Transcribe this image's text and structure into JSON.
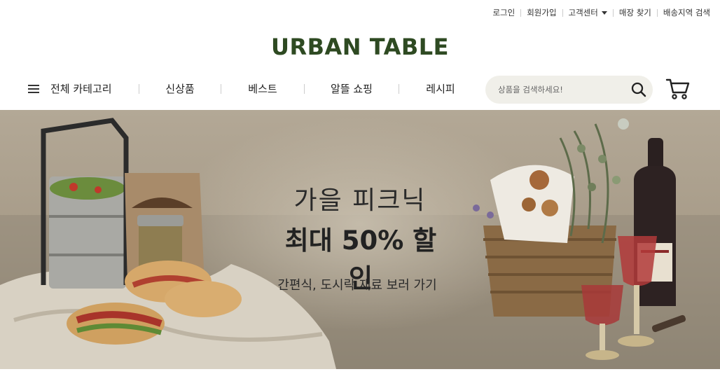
{
  "utility": {
    "login": "로그인",
    "signup": "회원가입",
    "support": "고객센터",
    "store_finder": "매장 찾기",
    "delivery_search": "배송지역 검색"
  },
  "logo": "URBAN TABLE",
  "nav": {
    "all_categories": "전체 카테고리",
    "items": [
      "신상품",
      "베스트",
      "알뜰 쇼핑",
      "레시피"
    ]
  },
  "search": {
    "placeholder": "상품을 검색하세요!"
  },
  "banner": {
    "line1": "가을 피크닉",
    "line2": "최대 50% 할인",
    "line3": "간편식, 도시락 재료 보러 가기"
  },
  "colors": {
    "brand": "#2e4a22",
    "search_bg": "#f0efe9",
    "banner_bg": "#a89c8b"
  },
  "icons": [
    "menu-icon",
    "search-icon",
    "cart-icon",
    "chevron-down-icon"
  ]
}
